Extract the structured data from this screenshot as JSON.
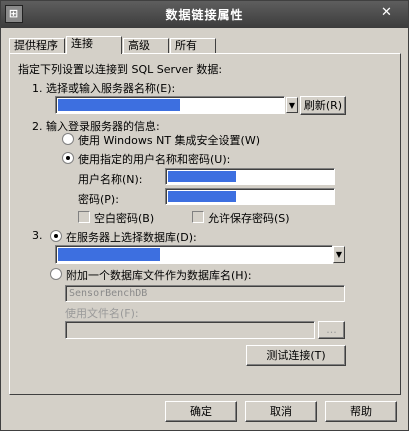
{
  "window": {
    "title": "数据链接属性",
    "close_glyph": "✕",
    "icon_glyph": "⊞"
  },
  "tabs": [
    "提供程序",
    "连接",
    "高级",
    "所有"
  ],
  "connection": {
    "intro": "指定下列设置以连接到 SQL Server 数据:",
    "step1_label": "1. 选择或输入服务器名称(E):",
    "refresh_label": "刷新(R)",
    "step2_label": "2. 输入登录服务器的信息:",
    "radio_nt": "使用 Windows NT 集成安全设置(W)",
    "radio_user": "使用指定的用户名称和密码(U):",
    "username_label": "用户名称(N):",
    "password_label": "密码(P):",
    "blank_password": "空白密码(B)",
    "allow_save": "允许保存密码(S)",
    "step3_prefix": "3.",
    "radio_db": "在服务器上选择数据库(D):",
    "radio_attach": "附加一个数据库文件作为数据库名(H):",
    "attach_value": "SensorBenchDB",
    "use_filename": "使用文件名(F):",
    "browse_label": "...",
    "test_label": "测试连接(T)"
  },
  "footer": {
    "ok": "确定",
    "cancel": "取消",
    "help": "帮助"
  },
  "icons": {
    "dropdown": "▼"
  },
  "colors": {
    "selection": "#3d6fe0",
    "titlebar": "#4a4a4a"
  }
}
